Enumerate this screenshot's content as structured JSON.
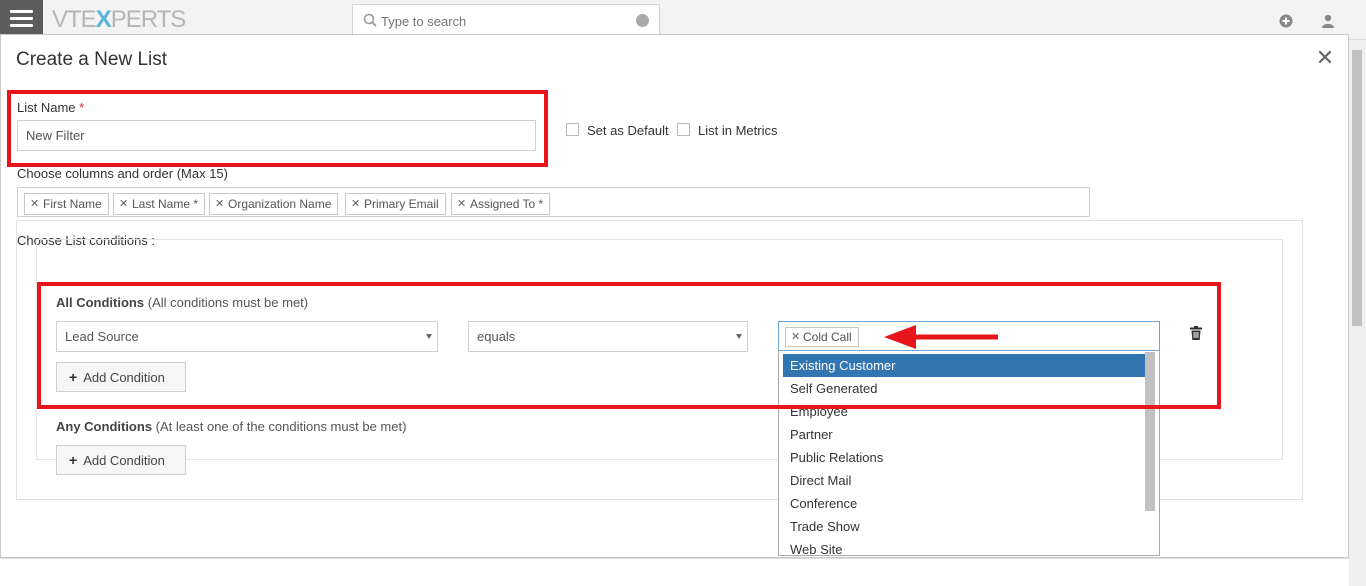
{
  "app": {
    "logo": {
      "left": "VTE",
      "x": "X",
      "right": "PERTS"
    },
    "search_placeholder": "Type to search"
  },
  "modal": {
    "title": "Create a New List",
    "close_icon": "close-icon",
    "list_name": {
      "label": "List Name",
      "required_mark": "*",
      "value": "New Filter"
    },
    "set_default_label": "Set as Default",
    "list_in_metrics_label": "List in Metrics",
    "columns": {
      "label": "Choose columns and order (Max 15)",
      "tags": [
        "First Name",
        "Last Name *",
        "Organization Name",
        "Primary Email",
        "Assigned To *"
      ]
    },
    "conditions_label": "Choose List conditions :",
    "all_conditions": {
      "title": "All Conditions",
      "subtitle": "(All conditions must be met)",
      "field": "Lead Source",
      "operator": "equals",
      "value_tag": "Cold Call",
      "add_label": "Add Condition"
    },
    "any_conditions": {
      "title": "Any Conditions",
      "subtitle": "(At least one of the conditions must be met)",
      "add_label": "Add Condition"
    },
    "dropdown_options": [
      "Existing Customer",
      "Self Generated",
      "Employee",
      "Partner",
      "Public Relations",
      "Direct Mail",
      "Conference",
      "Trade Show",
      "Web Site"
    ],
    "dropdown_selected": "Existing Customer"
  },
  "colors": {
    "highlight": "#e8141c",
    "option_active": "#3276b1",
    "brand_accent": "#5bb3d8"
  }
}
